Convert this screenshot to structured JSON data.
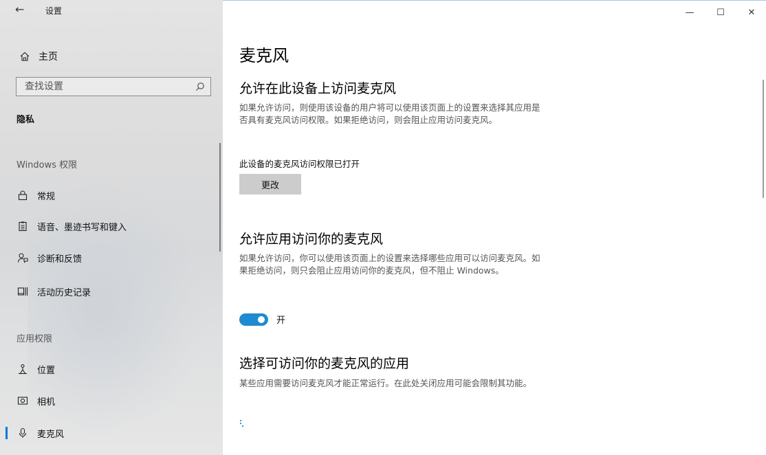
{
  "window": {
    "title": "设置",
    "controls": {
      "minimize": "—",
      "maximize": "☐",
      "close": "✕"
    }
  },
  "sidebar": {
    "home_label": "主页",
    "search_placeholder": "查找设置",
    "section_title": "隐私",
    "groups": [
      {
        "label": "Windows 权限",
        "items": [
          {
            "label": "常规",
            "icon": "lock-icon"
          },
          {
            "label": "语音、墨迹书写和键入",
            "icon": "clipboard-icon"
          },
          {
            "label": "诊断和反馈",
            "icon": "feedback-person-icon"
          },
          {
            "label": "活动历史记录",
            "icon": "activity-history-icon"
          }
        ]
      },
      {
        "label": "应用权限",
        "items": [
          {
            "label": "位置",
            "icon": "location-person-icon"
          },
          {
            "label": "相机",
            "icon": "camera-icon"
          },
          {
            "label": "麦克风",
            "icon": "microphone-icon",
            "active": true
          }
        ]
      }
    ],
    "accent_color": "#0078d7"
  },
  "main": {
    "page_title": "麦克风",
    "device_section": {
      "heading": "允许在此设备上访问麦克风",
      "description": "如果允许访问，则使用该设备的用户将可以使用该页面上的设置来选择其应用是否具有麦克风访问权限。如果拒绝访问，则会阻止应用访问麦克风。",
      "status": "此设备的麦克风访问权限已打开",
      "change_button": "更改"
    },
    "apps_section": {
      "heading": "允许应用访问你的麦克风",
      "description": "如果允许访问，你可以使用该页面上的设置来选择哪些应用可以访问麦克风。如果拒绝访问，则只会阻止应用访问你的麦克风，但不阻止 Windows。",
      "toggle_state": "开",
      "toggle_on": true,
      "toggle_color": "#1e8bd0"
    },
    "choose_section": {
      "heading": "选择可访问你的麦克风的应用",
      "description": "某些应用需要访问麦克风才能正常运行。在此处关闭应用可能会限制其功能。"
    }
  }
}
